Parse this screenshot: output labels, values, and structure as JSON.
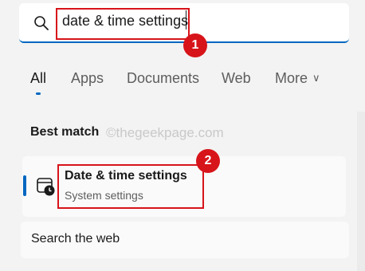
{
  "search": {
    "query": "date & time settings",
    "icon": "search-icon"
  },
  "annotations": {
    "badge_1": "1",
    "badge_2": "2",
    "highlight_color": "#d7141a"
  },
  "tabs": [
    {
      "label": "All",
      "active": true
    },
    {
      "label": "Apps",
      "active": false
    },
    {
      "label": "Documents",
      "active": false
    },
    {
      "label": "Web",
      "active": false
    },
    {
      "label": "More",
      "active": false
    }
  ],
  "tabs_more_chevron": "∨",
  "best_match": {
    "heading": "Best match",
    "watermark": "©thegeekpage.com",
    "result": {
      "title": "Date & time settings",
      "subtitle": "System settings",
      "icon": "date-time-settings-icon"
    }
  },
  "web_section": {
    "label": "Search the web"
  },
  "colors": {
    "accent": "#0067c0",
    "background": "#f3f3f3"
  }
}
